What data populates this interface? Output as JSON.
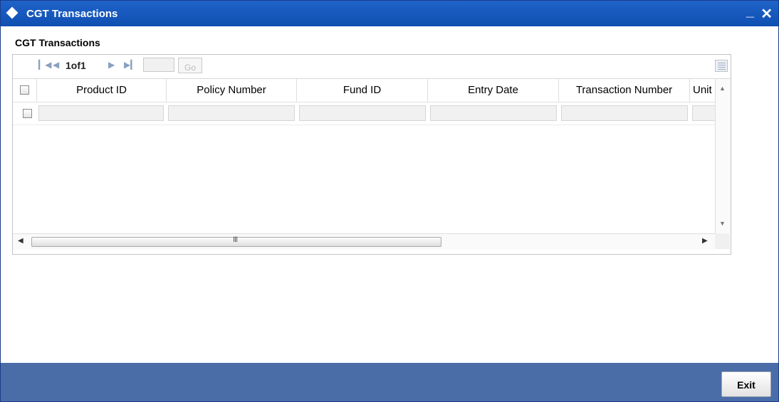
{
  "window": {
    "title": "CGT Transactions",
    "minimize_label": "_",
    "close_label": "✕"
  },
  "section": {
    "title": "CGT Transactions"
  },
  "pagination": {
    "first_icon": "first-page-icon",
    "prev_icon": "prev-page-icon",
    "page_text": "1of1",
    "next_icon": "next-page-icon",
    "last_icon": "last-page-icon",
    "page_input_value": "",
    "go_label": "Go"
  },
  "table": {
    "columns": [
      "Product ID",
      "Policy Number",
      "Fund ID",
      "Entry Date",
      "Transaction Number",
      "Unit"
    ],
    "rows": [
      [
        "",
        "",
        "",
        "",
        "",
        ""
      ]
    ]
  },
  "scrollbar": {
    "grip": "III"
  },
  "footer": {
    "exit_label": "Exit"
  },
  "colors": {
    "title_bar": "#1657be",
    "footer": "#4a6da8"
  }
}
